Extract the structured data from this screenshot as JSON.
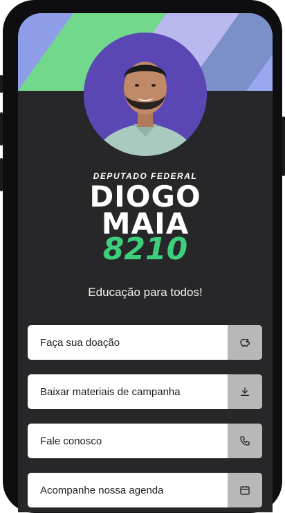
{
  "profile": {
    "role": "DEPUTADO FEDERAL",
    "name_line1": "DIOGO",
    "name_line2": "MAIA",
    "number": "8210",
    "tagline": "Educação para todos!"
  },
  "links": [
    {
      "label": "Faça sua doação",
      "icon": "piggy-bank-icon"
    },
    {
      "label": "Baixar materiais de campanha",
      "icon": "download-icon"
    },
    {
      "label": "Fale conosco",
      "icon": "phone-icon"
    },
    {
      "label": "Acompanhe nossa agenda",
      "icon": "calendar-icon"
    }
  ],
  "colors": {
    "screen_bg": "#27272a",
    "accent_green": "#3ecf7d",
    "avatar_bg": "#5b47b4",
    "banner_blue": "#8f9ee8",
    "banner_green": "#72d88c",
    "banner_lavender": "#b9b8ef"
  }
}
